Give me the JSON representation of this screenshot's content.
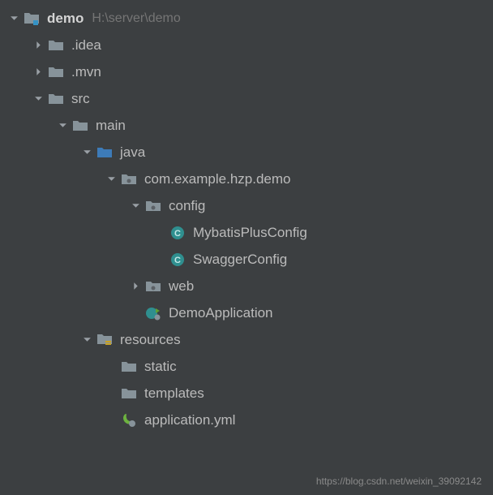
{
  "root": {
    "name": "demo",
    "path": "H:\\server\\demo"
  },
  "nodes": {
    "idea": ".idea",
    "mvn": ".mvn",
    "src": "src",
    "main": "main",
    "java": "java",
    "pkg": "com.example.hzp.demo",
    "config": "config",
    "mybatis": "MybatisPlusConfig",
    "swagger": "SwaggerConfig",
    "web": "web",
    "demoapp": "DemoApplication",
    "resources": "resources",
    "static": "static",
    "templates": "templates",
    "appyml": "application.yml"
  },
  "watermark": "https://blog.csdn.net/weixin_39092142"
}
